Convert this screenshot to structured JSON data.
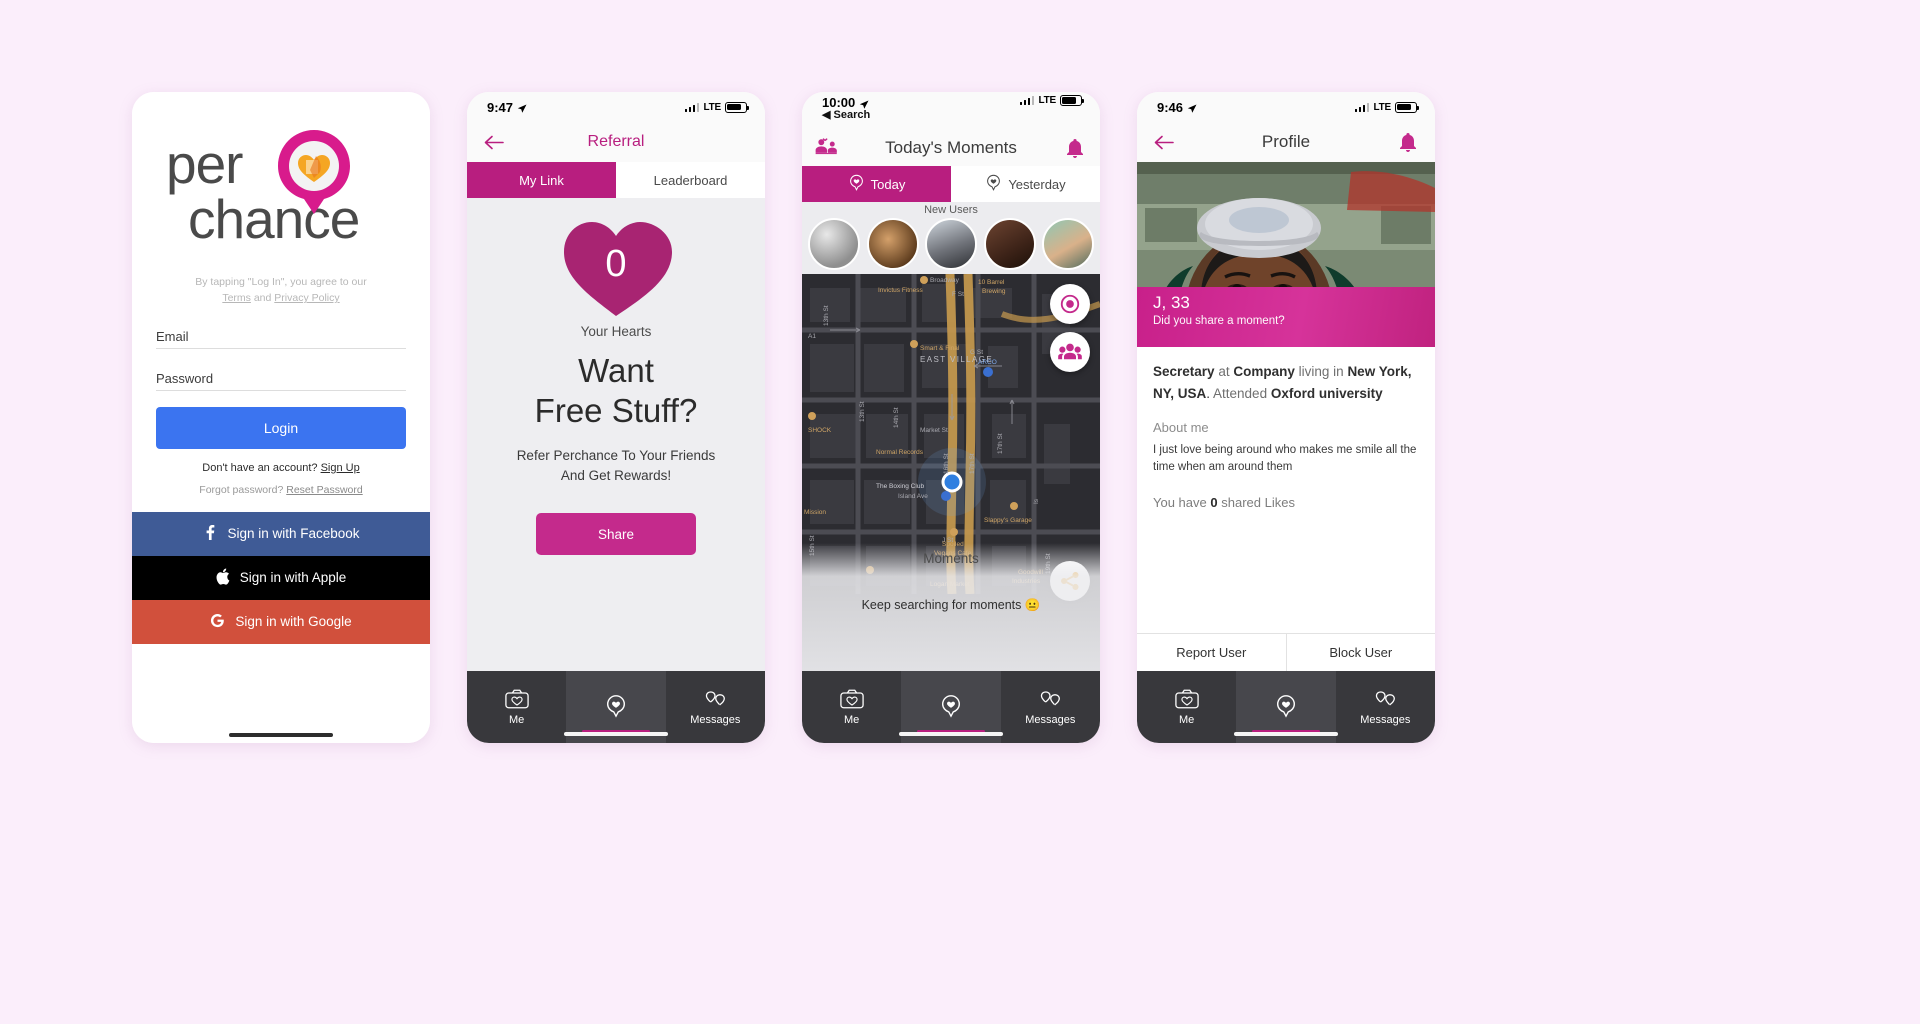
{
  "canvas": {
    "background": "#fbeefb"
  },
  "brand": {
    "pink": "#b81e7f",
    "magenta": "#c42a8c",
    "blue": "#3b74f0"
  },
  "login_screen": {
    "logo": {
      "line1": "per",
      "line2": "chance",
      "icon": "perchance-pin-heart-logo"
    },
    "terms_prefix": "By tapping \"Log In\", you agree to our",
    "terms_link": "Terms",
    "terms_and": "and",
    "privacy_link": "Privacy Policy",
    "email_placeholder": "Email",
    "email_value": "",
    "password_placeholder": "Password",
    "password_value": "",
    "login_button": "Login",
    "signup_prompt": "Don't have an account?",
    "signup_link": "Sign Up",
    "forgot_prompt": "Forgot password?",
    "reset_link": "Reset Password",
    "social": [
      {
        "label": "Sign in with Facebook",
        "icon": "facebook-icon",
        "color": "#3f5b96"
      },
      {
        "label": "Sign in with Apple",
        "icon": "apple-icon",
        "color": "#000000"
      },
      {
        "label": "Sign in with Google",
        "icon": "google-icon",
        "color": "#d1503c"
      }
    ]
  },
  "referral_screen": {
    "status": {
      "time": "9:47",
      "location_icon": "location-arrow-icon",
      "carrier": "LTE",
      "battery_icon": "battery-icon",
      "signal_icon": "signal-bars-icon"
    },
    "back_icon": "back-arrow-icon",
    "title": "Referral",
    "tabs": [
      {
        "label": "My Link",
        "active": true
      },
      {
        "label": "Leaderboard",
        "active": false
      }
    ],
    "hearts_count": "0",
    "hearts_label": "Your Hearts",
    "headline_line1": "Want",
    "headline_line2": "Free Stuff?",
    "sub_line1": "Refer Perchance To Your Friends",
    "sub_line2": "And Get Rewards!",
    "share_button": "Share",
    "tabbar": [
      {
        "label": "Me",
        "icon": "camera-heart-icon"
      },
      {
        "label": "",
        "icon": "perchance-pin-icon"
      },
      {
        "label": "Messages",
        "icon": "messages-hearts-icon"
      }
    ]
  },
  "moments_screen": {
    "status": {
      "time": "10:00",
      "location_icon": "location-arrow-icon",
      "back_label": "Search",
      "carrier": "LTE"
    },
    "header_icon": "people-heart-icon",
    "title": "Today's Moments",
    "bell_icon": "bell-icon",
    "tabs": [
      {
        "label": "Today",
        "active": true,
        "icon": "perchance-pin-icon"
      },
      {
        "label": "Yesterday",
        "active": false,
        "icon": "perchance-pin-icon"
      }
    ],
    "new_users_label": "New Users",
    "new_users": [
      {
        "name": "user-1"
      },
      {
        "name": "user-2"
      },
      {
        "name": "user-3"
      },
      {
        "name": "user-4"
      },
      {
        "name": "user-5"
      }
    ],
    "map_labels": [
      "Broadway",
      "13th St",
      "A1",
      "Invictus Fitness",
      "10 Barrel Brewing",
      "F St",
      "EAST VILLAGE",
      "G St",
      "Smart & Final",
      "ARCO",
      "16th St",
      "17th St",
      "14th St",
      "SHOCK",
      "Market St",
      "Normal Records",
      "15th St",
      "Island Ave",
      "The Boxing Club",
      "Slappy's Garage",
      "Spoiled Vegans Cafe",
      "J St",
      "19th St",
      "Goodwill Industries",
      "Logan Market",
      "Mission"
    ],
    "fabs": [
      {
        "name": "target-locate-button",
        "icon": "target-icon"
      },
      {
        "name": "people-button",
        "icon": "people-group-icon"
      },
      {
        "name": "share-button",
        "icon": "share-icon"
      }
    ],
    "moments_title": "Moments",
    "empty_text": "Keep searching for moments 😐",
    "tabbar": [
      {
        "label": "Me",
        "icon": "camera-heart-icon"
      },
      {
        "label": "",
        "icon": "perchance-pin-icon"
      },
      {
        "label": "Messages",
        "icon": "messages-hearts-icon"
      }
    ]
  },
  "profile_screen": {
    "status": {
      "time": "9:46",
      "location_icon": "location-arrow-icon",
      "carrier": "LTE"
    },
    "back_icon": "back-arrow-icon",
    "title": "Profile",
    "bell_icon": "bell-icon",
    "banner_name": "J, 33",
    "banner_sub": "Did you share a moment?",
    "bio": {
      "job": "Secretary",
      "at": "at",
      "company": "Company",
      "living": "living in",
      "location": "New York, NY, USA",
      "attended": "Attended",
      "school": "Oxford",
      "school_suffix": "university"
    },
    "about_heading": "About me",
    "about_text": "I just love being around who makes me smile all the time when am around them",
    "likes_prefix": "You have",
    "likes_count": "0",
    "likes_suffix": "shared Likes",
    "actions": [
      {
        "label": "Report User"
      },
      {
        "label": "Block User"
      }
    ],
    "tabbar": [
      {
        "label": "Me",
        "icon": "camera-heart-icon"
      },
      {
        "label": "",
        "icon": "perchance-pin-icon"
      },
      {
        "label": "Messages",
        "icon": "messages-hearts-icon"
      }
    ]
  }
}
